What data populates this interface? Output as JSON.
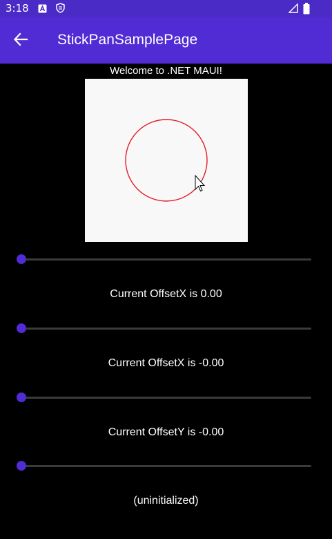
{
  "status_bar": {
    "time": "3:18",
    "icons": [
      "a-box-icon",
      "shield-icon",
      "signal-icon",
      "battery-icon"
    ]
  },
  "app_bar": {
    "title": "StickPanSamplePage",
    "back_icon": "arrow-left-icon"
  },
  "main": {
    "welcome": "Welcome to .NET MAUI!",
    "canvas": {
      "background": "#f8f8f8",
      "circle_color": "#e31b23"
    },
    "sliders": [
      {
        "value": 0
      },
      {
        "value": 0
      },
      {
        "value": 0
      },
      {
        "value": 0
      }
    ],
    "labels": [
      "Current OffsetX is 0.00",
      "Current OffsetX is -0.00",
      "Current OffsetY is -0.00",
      "(uninitialized)"
    ]
  },
  "colors": {
    "accent": "#512bd4",
    "status_bar": "#4a2bc6",
    "background": "#000000",
    "track": "#3b3b3b"
  }
}
